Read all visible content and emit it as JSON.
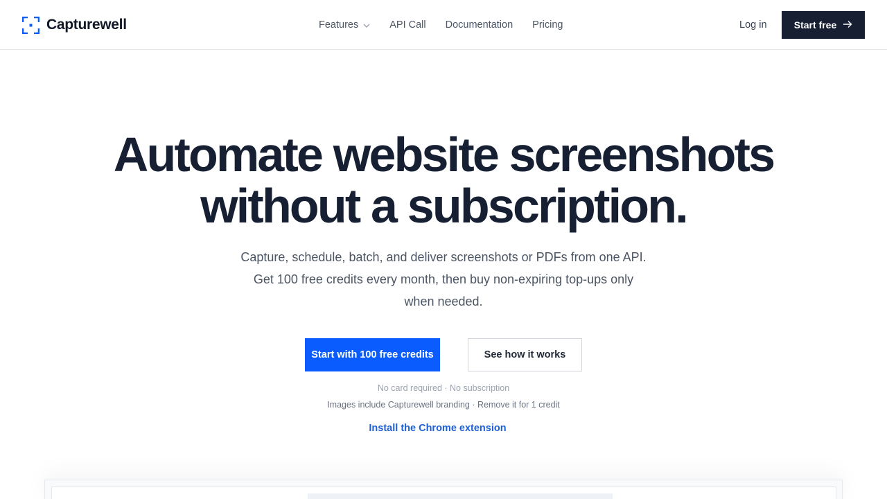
{
  "brand": {
    "name": "Capturewell",
    "accent": "#0b5cff",
    "dark": "#172033"
  },
  "nav": {
    "items": [
      {
        "label": "Features",
        "has_dropdown": true
      },
      {
        "label": "API Call",
        "has_dropdown": false
      },
      {
        "label": "Documentation",
        "has_dropdown": false
      },
      {
        "label": "Pricing",
        "has_dropdown": false
      }
    ],
    "dropdown_icon": "chevron-down-icon"
  },
  "header_actions": {
    "login_label": "Log in",
    "start_free_label": "Start free",
    "start_free_icon": "arrow-right-icon"
  },
  "hero": {
    "headline_line1": "Automate website screenshots",
    "headline_line2": "without a subscription.",
    "subtext_line1": "Capture, schedule, batch, and deliver screenshots or PDFs from one API.",
    "subtext_line2": "Get 100 free credits every month, then buy non-expiring top-ups only",
    "subtext_line3": "when needed.",
    "primary_cta": "Start with 100 free credits",
    "secondary_cta": "See how it works",
    "note_1": "No card required · No subscription",
    "note_2": "Images include Capturewell branding · Remove it for 1 credit",
    "chrome_link": "Install the Chrome extension"
  }
}
